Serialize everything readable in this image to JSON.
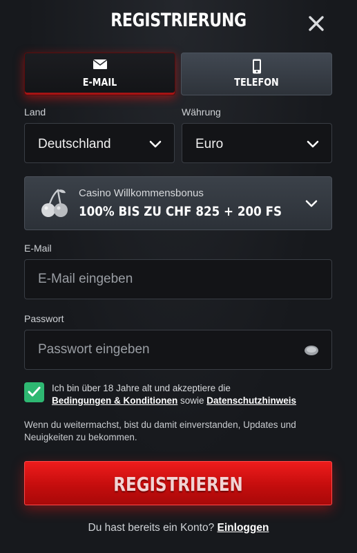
{
  "header": {
    "title": "REGISTRIERUNG"
  },
  "tabs": [
    {
      "label": "E-MAIL",
      "icon": "envelope-icon",
      "active": true
    },
    {
      "label": "TELEFON",
      "icon": "phone-icon",
      "active": false
    }
  ],
  "country": {
    "label": "Land",
    "value": "Deutschland"
  },
  "currency": {
    "label": "Währung",
    "value": "Euro"
  },
  "bonus": {
    "icon": "cherry-icon",
    "subtitle": "Casino Willkommensbonus",
    "title": "100% BIS ZU CHF 825 + 200 FS"
  },
  "email": {
    "label": "E-Mail",
    "placeholder": "E-Mail eingeben"
  },
  "password": {
    "label": "Passwort",
    "placeholder": "Passwort eingeben"
  },
  "consent": {
    "checked": true,
    "text_1": "Ich bin über 18 Jahre alt und akzeptiere die",
    "link_terms": "Bedingungen & Konditionen",
    "text_and": " sowie ",
    "link_privacy": "Datenschutzhinweis"
  },
  "note": "Wenn du weitermachst, bist du damit einverstanden, Updates und Neuigkeiten zu bekommen.",
  "register_label": "REGISTRIEREN",
  "login": {
    "prompt": "Du hast bereits ein Konto? ",
    "link": "Einloggen"
  },
  "colors": {
    "accent_red": "#e01414",
    "check_green": "#2eb872",
    "background": "#17191d"
  }
}
